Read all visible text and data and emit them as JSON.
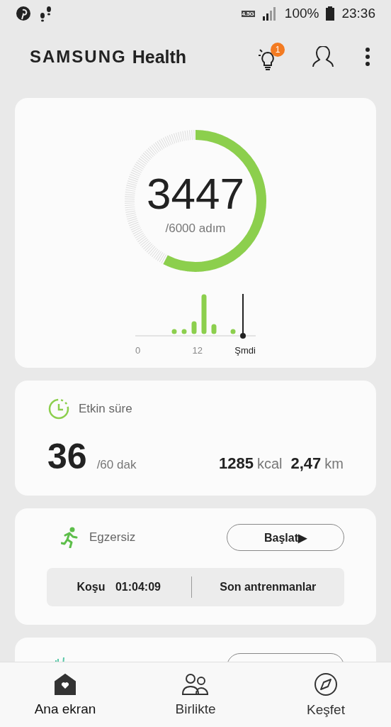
{
  "status_bar": {
    "network": "4.5G",
    "battery": "100%",
    "time": "23:36"
  },
  "header": {
    "brand": "SAMSUNG",
    "app": "Health",
    "notification_count": "1"
  },
  "steps": {
    "count": "3447",
    "goal": "/6000 adım",
    "axis_labels": [
      "0",
      "12",
      "Şmdi"
    ]
  },
  "active_time": {
    "title": "Etkin süre",
    "minutes": "36",
    "goal": "/60 dak",
    "calories": "1285",
    "calories_unit": "kcal",
    "distance": "2,47",
    "distance_unit": "km"
  },
  "exercise": {
    "title": "Egzersiz",
    "start_button": "Başlat▶",
    "last_workout": {
      "type": "Koşu",
      "duration": "01:04:09"
    },
    "recent_button": "Son antrenmanlar"
  },
  "nav": [
    {
      "label": "Ana ekran",
      "selected": true
    },
    {
      "label": "Birlikte",
      "selected": false
    },
    {
      "label": "Keşfet",
      "selected": false
    }
  ]
}
